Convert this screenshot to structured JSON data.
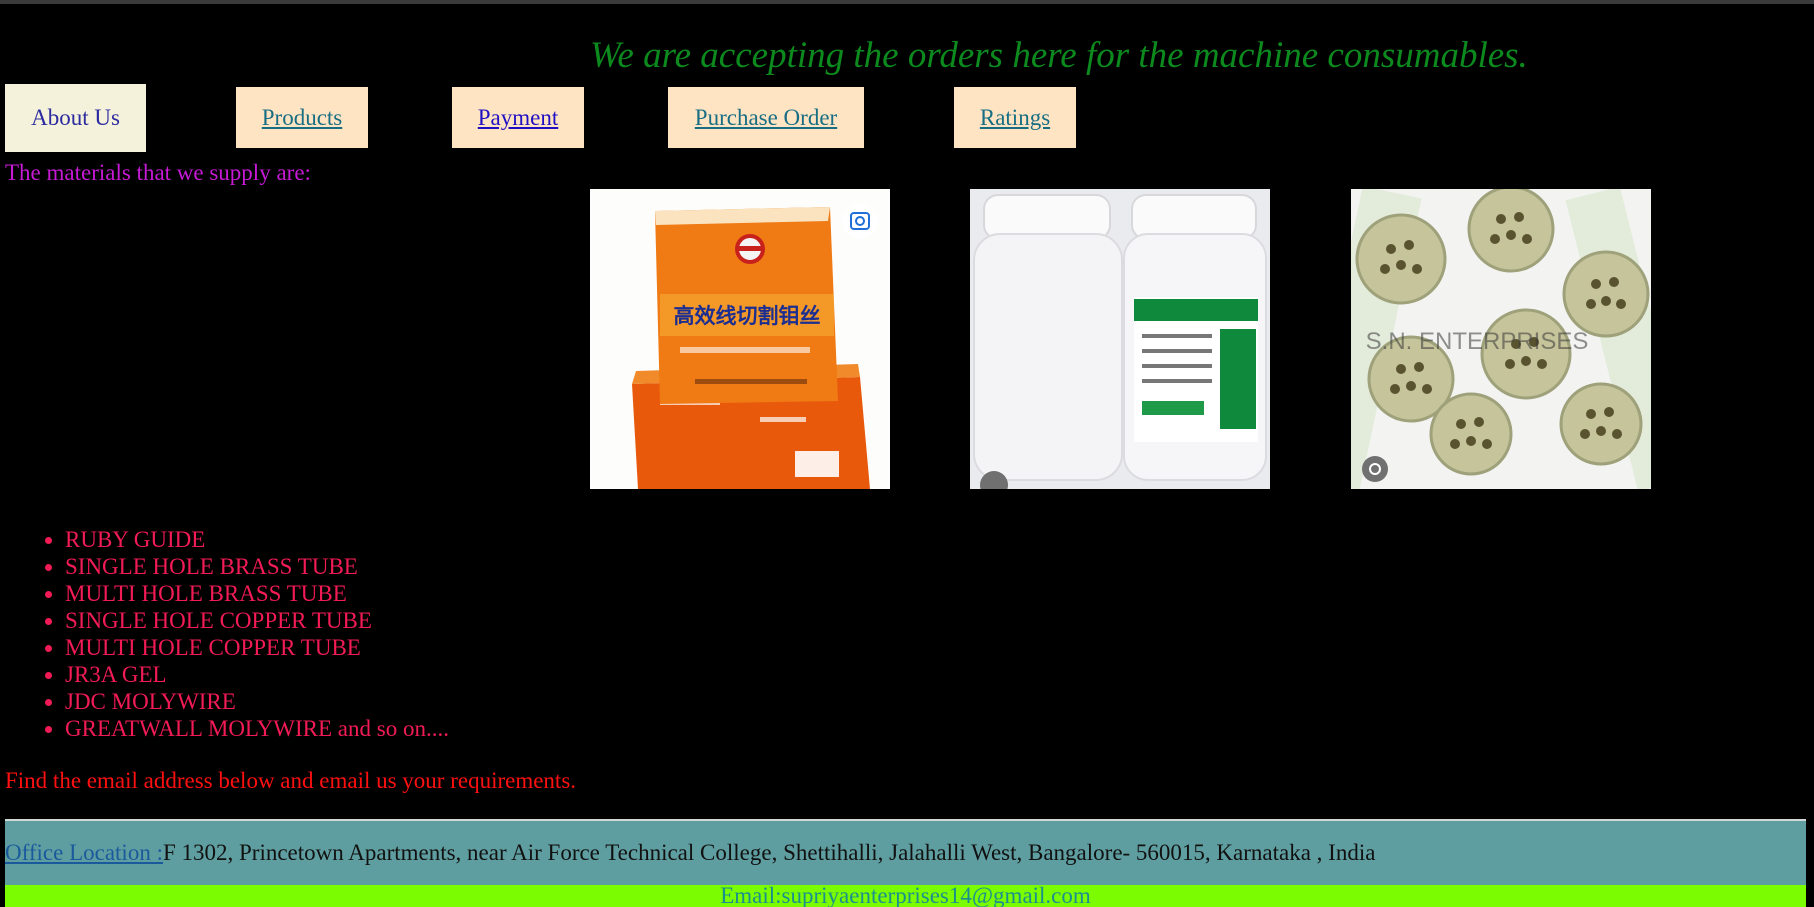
{
  "banner": "We are accepting the orders here for the machine consumables.",
  "nav": {
    "about": "About Us",
    "products": "Products",
    "payment": "Payment",
    "purchase_order": "Purchase Order",
    "ratings": "Ratings"
  },
  "intro": "The materials that we supply are:",
  "images": {
    "box_text": "高效线切割钼丝",
    "watermark": "S.N. ENTERPRISES"
  },
  "materials": [
    "RUBY GUIDE",
    "SINGLE HOLE BRASS TUBE",
    "MULTI HOLE BRASS TUBE",
    "SINGLE HOLE COPPER TUBE",
    "MULTI HOLE COPPER TUBE",
    "JR3A GEL",
    "JDC MOLYWIRE",
    "GREATWALL MOLYWIRE and so on...."
  ],
  "note": "Find the email address below and email us your requirements.",
  "office": {
    "label": "Office Location : ",
    "address": "F 1302, Princetown Apartments, near Air Force Technical College, Shettihalli, Jalahalli West, Bangalore- 560015, Karnataka , India"
  },
  "email": "Email:supriyaenterprises14@gmail.com"
}
